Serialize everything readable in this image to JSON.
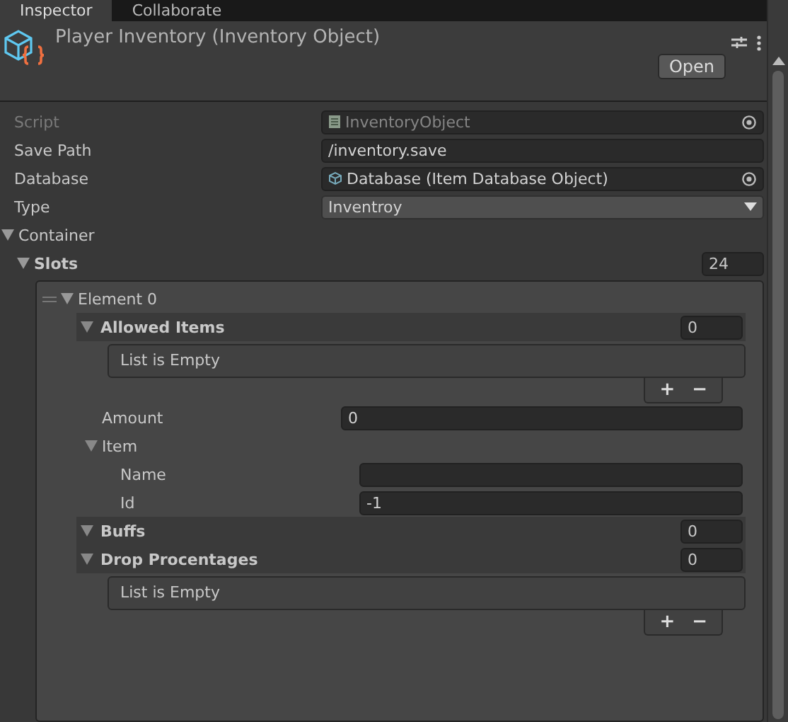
{
  "tabs": [
    {
      "label": "Inspector",
      "selected": true
    },
    {
      "label": "Collaborate",
      "selected": false
    }
  ],
  "header": {
    "title": "Player Inventory (Inventory Object)",
    "open_button": "Open"
  },
  "fields": [
    {
      "kind": "object",
      "label": "Script",
      "value": "InventoryObject",
      "disabled": true
    },
    {
      "kind": "text",
      "label": "Save Path",
      "value": "/inventory.save",
      "disabled": false
    },
    {
      "kind": "object",
      "label": "Database",
      "value": "Database (Item Database Object)",
      "disabled": false
    },
    {
      "kind": "dropdown",
      "label": "Type",
      "value": "Inventroy",
      "disabled": false
    }
  ],
  "container": {
    "label": "Container",
    "expanded": true,
    "slots": {
      "label": "Slots",
      "expanded": true,
      "count": "24",
      "elements": [
        {
          "label": "Element 0",
          "expanded": true,
          "rows": [
            {
              "kind": "list",
              "label": "Allowed Items",
              "count": "0",
              "expanded": true,
              "empty_text": "List is Empty",
              "add_label": "+",
              "remove_label": "−"
            },
            {
              "kind": "field",
              "label": "Amount",
              "value": "0"
            },
            {
              "kind": "foldout",
              "label": "Item",
              "expanded": true,
              "children": [
                {
                  "label": "Name"
                },
                {
                  "label": "Id",
                  "value": "-1"
                }
              ]
            },
            {
              "kind": "list",
              "label": "Buffs",
              "count": "0",
              "expanded": true
            },
            {
              "kind": "list",
              "label": "Drop Procentages",
              "count": "0",
              "expanded": true,
              "empty_text": "List is Empty",
              "add_label": "+",
              "remove_label": "−"
            }
          ]
        }
      ]
    }
  }
}
